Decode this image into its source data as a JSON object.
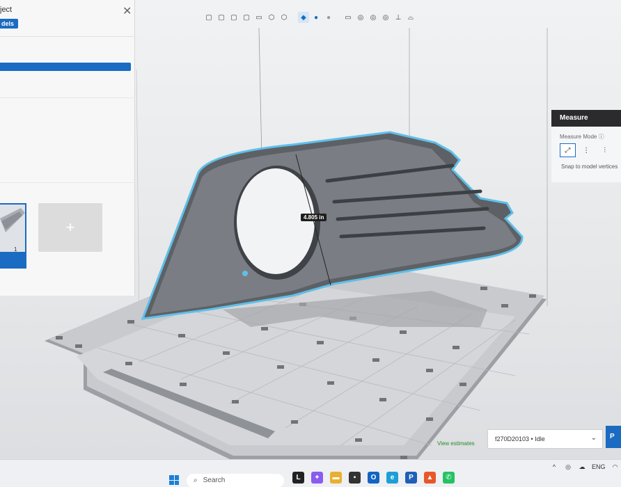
{
  "app": {
    "project_title": "ject",
    "models_tab": "dels",
    "close_glyph": "✕"
  },
  "toolbar": {
    "buttons": [
      {
        "name": "view-front-icon",
        "glyph": "▢"
      },
      {
        "name": "view-back-icon",
        "glyph": "▢"
      },
      {
        "name": "view-left-icon",
        "glyph": "▢"
      },
      {
        "name": "view-right-icon",
        "glyph": "▢"
      },
      {
        "name": "view-top-icon",
        "glyph": "▭"
      },
      {
        "name": "view-iso-icon",
        "glyph": "⬡"
      },
      {
        "name": "view-perspective-icon",
        "glyph": "⬡"
      },
      {
        "name": "shaded-icon",
        "glyph": "◆"
      },
      {
        "name": "material-icon",
        "glyph": "●"
      },
      {
        "name": "xray-icon",
        "glyph": "●"
      },
      {
        "name": "wireframe-icon",
        "glyph": "▭"
      },
      {
        "name": "section-icon",
        "glyph": "◎"
      },
      {
        "name": "overhang-icon",
        "glyph": "◎"
      },
      {
        "name": "support-icon",
        "glyph": "◎"
      },
      {
        "name": "axis-icon",
        "glyph": "⊥"
      },
      {
        "name": "camera-icon",
        "glyph": "⌓"
      }
    ]
  },
  "left_panel": {
    "model_count": "1",
    "add_glyph": "+"
  },
  "measure": {
    "header": "Measure",
    "mode_label": "Measure Mode",
    "snap_label": "Snap to model vertices",
    "modes": [
      {
        "name": "point-to-point-icon",
        "glyph": "⤢"
      },
      {
        "name": "point-to-plane-icon",
        "glyph": "⋮"
      },
      {
        "name": "plane-to-plane-icon",
        "glyph": "⫶"
      }
    ]
  },
  "measurement": {
    "value": "4.805 in"
  },
  "printer": {
    "view_estimates": "View estimates",
    "selected": "f270D20103 • Idle",
    "print_label": "P"
  },
  "taskbar": {
    "search_placeholder": "Search",
    "apps": [
      {
        "name": "widgets-icon",
        "glyph": "L",
        "color": "#222222"
      },
      {
        "name": "copilot-icon",
        "glyph": "✦",
        "color": "#8a5cf0"
      },
      {
        "name": "file-explorer-icon",
        "glyph": "▬",
        "color": "#e8b030"
      },
      {
        "name": "app-icon-dark",
        "glyph": "▪",
        "color": "#333333"
      },
      {
        "name": "outlook-icon",
        "glyph": "O",
        "color": "#1464c4"
      },
      {
        "name": "edge-icon",
        "glyph": "e",
        "color": "#1d9fd6"
      },
      {
        "name": "preform-icon",
        "glyph": "P",
        "color": "#1f5fb8"
      },
      {
        "name": "app-icon-orange",
        "glyph": "▲",
        "color": "#e8562a"
      },
      {
        "name": "whatsapp-icon",
        "glyph": "✆",
        "color": "#25c265"
      }
    ],
    "tray": {
      "chevron": "^",
      "language": "ENG"
    }
  }
}
